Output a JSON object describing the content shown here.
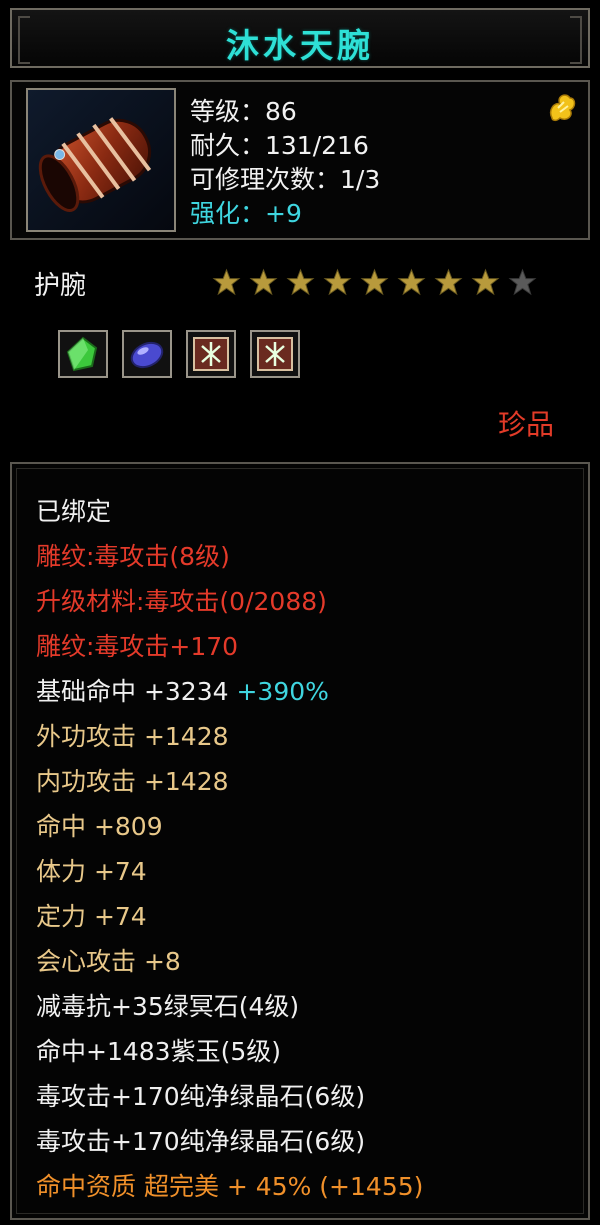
{
  "item": {
    "name": "沐水天腕",
    "level": "等级：86",
    "durability": "耐久：131/216",
    "repairs": "可修理次数：1/3",
    "enhance": "强化：+9",
    "type": "护腕",
    "rarity": "珍品",
    "stars": {
      "filled": 8,
      "total": 9
    },
    "gems": [
      "green-crystal-icon",
      "purple-jade-icon",
      "carving-rune-icon",
      "carving-rune-icon"
    ]
  },
  "attributes": {
    "bound": "已绑定",
    "engrave": "雕纹:毒攻击(8级)",
    "upgrade_material": "升级材料:毒攻击(0/2088)",
    "engrave_bonus": "雕纹:毒攻击+170",
    "base_hit_label": "基础命中  +3234 ",
    "base_hit_pct": "+390%",
    "outer_attack": "外功攻击  +1428",
    "inner_attack": "内功攻击  +1428",
    "hit": "命中  +809",
    "stamina": "体力  +74",
    "focus": "定力  +74",
    "crit_attack": "会心攻击  +8",
    "gem1": "减毒抗+35绿冥石(4级)",
    "gem2": "命中+1483紫玉(5级)",
    "gem3": "毒攻击+170纯净绿晶石(6级)",
    "gem4": "毒攻击+170纯净绿晶石(6级)",
    "quality": "命中资质  超完美  + 45% (+1455)"
  },
  "colors": {
    "title": "#2ee0d6",
    "rare": "#e23b28",
    "enhance": "#3fd6e0",
    "star_filled": "#b89a3c",
    "star_empty": "#5a5a5a"
  }
}
